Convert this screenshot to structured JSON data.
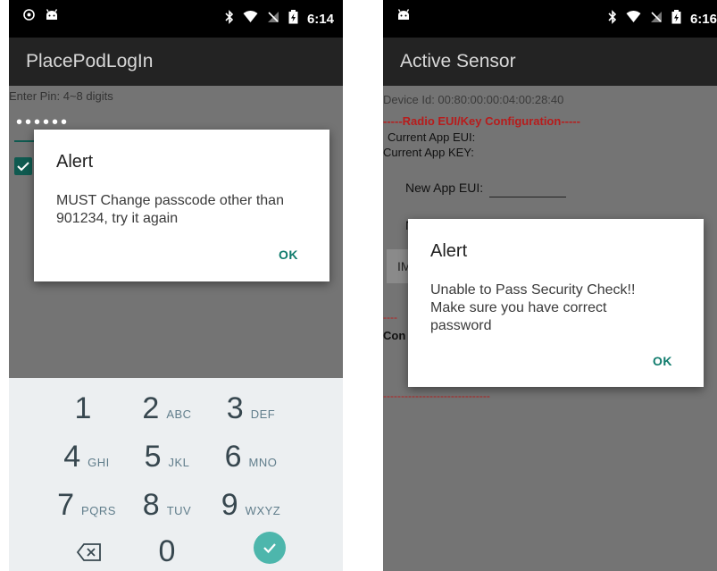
{
  "screen1": {
    "status_time": "6:14",
    "app_title": "PlacePodLogIn",
    "pin_label": "Enter Pin: 4~8 digits",
    "pin_value": "••••••",
    "checkbox_checked": true,
    "alert": {
      "title": "Alert",
      "message": "MUST Change passcode other than 901234, try it again",
      "ok": "OK"
    },
    "keypad": [
      {
        "num": "1",
        "letters": ""
      },
      {
        "num": "2",
        "letters": "ABC"
      },
      {
        "num": "3",
        "letters": "DEF"
      },
      {
        "num": "4",
        "letters": "GHI"
      },
      {
        "num": "5",
        "letters": "JKL"
      },
      {
        "num": "6",
        "letters": "MNO"
      },
      {
        "num": "7",
        "letters": "PQRS"
      },
      {
        "num": "8",
        "letters": "TUV"
      },
      {
        "num": "9",
        "letters": "WXYZ"
      },
      {
        "num": "",
        "letters": ""
      },
      {
        "num": "0",
        "letters": ""
      },
      {
        "num": "",
        "letters": ""
      }
    ]
  },
  "screen2": {
    "status_time": "6:16",
    "app_title": "Active Sensor",
    "device_id": "Device Id: 00:80:00:00:04:00:28:40",
    "radio_header": "-----Radio EUI/Key Configuration-----",
    "current_app_eui": "Current App EUI:",
    "current_app_key": "Current App KEY:",
    "new_app_eui": "New App EUI:",
    "n_fragment": "N",
    "im_fragment": "IM",
    "dash_fragment": "----",
    "con_fragment": "Con",
    "dash_line": "------------------------------",
    "alert": {
      "title": "Alert",
      "message": "Unable to Pass Security Check!! Make sure you have correct password",
      "ok": "OK"
    }
  },
  "colors": {
    "accent": "#0f7b6c",
    "red": "#b71c1c",
    "dim": "#747474",
    "keypad_bg": "#eceff1",
    "fab": "#4db6ac"
  }
}
